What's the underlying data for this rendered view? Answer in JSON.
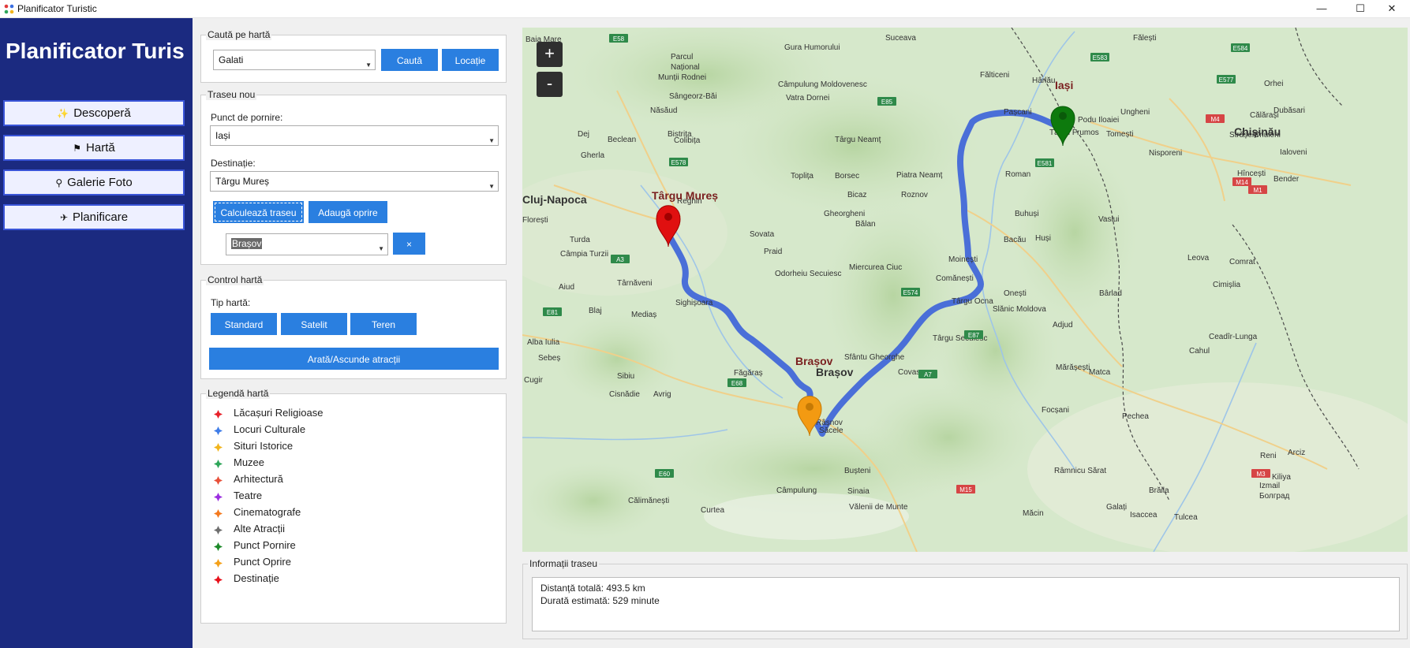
{
  "window": {
    "title": "Planificator Turistic",
    "minimize": "—",
    "maximize": "☐",
    "close": "✕"
  },
  "sidebar": {
    "app_title": "Planificator Turis",
    "items": [
      {
        "label": "Descoperă",
        "icon": "sparkle-icon",
        "glyph": "✨"
      },
      {
        "label": "Hartă",
        "icon": "flag-icon",
        "glyph": "⚑"
      },
      {
        "label": "Galerie Foto",
        "icon": "search-icon",
        "glyph": "⚲"
      },
      {
        "label": "Planificare",
        "icon": "airplane-icon",
        "glyph": "✈"
      }
    ]
  },
  "search": {
    "group_label": "Caută pe hartă",
    "value": "Galati",
    "search_button": "Caută",
    "location_button": "Locație"
  },
  "route": {
    "group_label": "Traseu nou",
    "start_label": "Punct de pornire:",
    "start_value": "Iași",
    "dest_label": "Destinație:",
    "dest_value": "Târgu Mureș",
    "calc_button": "Calculează traseu",
    "add_stop_button": "Adaugă oprire",
    "stop_value": "Brașov",
    "remove_stop_button": "×"
  },
  "map_control": {
    "group_label": "Control hartă",
    "type_label": "Tip hartă:",
    "standard": "Standard",
    "satellite": "Satelit",
    "terrain": "Teren",
    "toggle_attractions": "Arată/Ascunde atracții"
  },
  "legend": {
    "group_label": "Legendă hartă",
    "items": [
      {
        "label": "Lăcașuri Religioase",
        "color": "#e8222b"
      },
      {
        "label": "Locuri Culturale",
        "color": "#3f7de8"
      },
      {
        "label": "Situri Istorice",
        "color": "#f2b51d"
      },
      {
        "label": "Muzee",
        "color": "#2fa65a"
      },
      {
        "label": "Arhitectură",
        "color": "#e8503a"
      },
      {
        "label": "Teatre",
        "color": "#9b2ee0"
      },
      {
        "label": "Cinematografe",
        "color": "#f47a1f"
      },
      {
        "label": "Alte Atracții",
        "color": "#6f6f6f"
      },
      {
        "label": "Punct Pornire",
        "color": "#1d8a2a"
      },
      {
        "label": "Punct Oprire",
        "color": "#f4a11a"
      },
      {
        "label": "Destinație",
        "color": "#e8111b"
      }
    ]
  },
  "map": {
    "zoom_in": "+",
    "zoom_out": "-",
    "route_color": "#4a6fd8",
    "markers": {
      "start_label": "Iași",
      "stop_label": "Brașov",
      "dest_label": "Târgu Mureș"
    },
    "places": [
      {
        "name": "Baia Mare"
      },
      {
        "name": "Suceava"
      },
      {
        "name": "Parcul"
      },
      {
        "name": "Național"
      },
      {
        "name": "Munții Rodnei"
      },
      {
        "name": "Gura Humorului"
      },
      {
        "name": "Câmpulung Moldovenesc"
      },
      {
        "name": "Vatra Dornei"
      },
      {
        "name": "Sângeorz-Băi"
      },
      {
        "name": "Năsăud"
      },
      {
        "name": "Bistrița"
      },
      {
        "name": "Beclean"
      },
      {
        "name": "Dej"
      },
      {
        "name": "Gherla"
      },
      {
        "name": "Colibița"
      },
      {
        "name": "Cluj-Napoca"
      },
      {
        "name": "Florești"
      },
      {
        "name": "Turda"
      },
      {
        "name": "Câmpia Turzii"
      },
      {
        "name": "Aiud"
      },
      {
        "name": "Târnăveni"
      },
      {
        "name": "Blaj"
      },
      {
        "name": "Mediaș"
      },
      {
        "name": "Alba Iulia"
      },
      {
        "name": "Sebeș"
      },
      {
        "name": "Sibiu"
      },
      {
        "name": "Cugir"
      },
      {
        "name": "Cisnădie"
      },
      {
        "name": "Avrig"
      },
      {
        "name": "Făgăraș"
      },
      {
        "name": "Sighișoara"
      },
      {
        "name": "Sovata"
      },
      {
        "name": "Praid"
      },
      {
        "name": "Odorheiu Secuiesc"
      },
      {
        "name": "Reghin"
      },
      {
        "name": "Toplița"
      },
      {
        "name": "Borsec"
      },
      {
        "name": "Gheorgheni"
      },
      {
        "name": "Bălan"
      },
      {
        "name": "Miercurea Ciuc"
      },
      {
        "name": "Bicaz"
      },
      {
        "name": "Piatra Neamț"
      },
      {
        "name": "Roznov"
      },
      {
        "name": "Târgu Neamț"
      },
      {
        "name": "Fălticeni"
      },
      {
        "name": "Pașcani"
      },
      {
        "name": "Hârlău"
      },
      {
        "name": "Târgu Frumos"
      },
      {
        "name": "Podu Iloaiei"
      },
      {
        "name": "Roman"
      },
      {
        "name": "Buhuși"
      },
      {
        "name": "Bacău"
      },
      {
        "name": "Moinești"
      },
      {
        "name": "Comănești"
      },
      {
        "name": "Onești"
      },
      {
        "name": "Slănic Moldova"
      },
      {
        "name": "Târgu Ocna"
      },
      {
        "name": "Târgu Secuiesc"
      },
      {
        "name": "Adjud"
      },
      {
        "name": "Sfântu Gheorghe"
      },
      {
        "name": "Covasna"
      },
      {
        "name": "Brașov"
      },
      {
        "name": "Râșnov"
      },
      {
        "name": "Săcele"
      },
      {
        "name": "Bușteni"
      },
      {
        "name": "Sinaia"
      },
      {
        "name": "Câmpulung"
      },
      {
        "name": "Vălenii de Munte"
      },
      {
        "name": "Curtea"
      },
      {
        "name": "Călimănești"
      },
      {
        "name": "Focșani"
      },
      {
        "name": "Mărășești"
      },
      {
        "name": "Matca"
      },
      {
        "name": "Pechea"
      },
      {
        "name": "Galați"
      },
      {
        "name": "Brăila"
      },
      {
        "name": "Râmnicu Sărat"
      },
      {
        "name": "Măcin"
      },
      {
        "name": "Isaccea"
      },
      {
        "name": "Tulcea"
      },
      {
        "name": "Fălești"
      },
      {
        "name": "Ungheni"
      },
      {
        "name": "Tomești"
      },
      {
        "name": "Nisporeni"
      },
      {
        "name": "Chișinău"
      },
      {
        "name": "Orhei"
      },
      {
        "name": "Călărași"
      },
      {
        "name": "Strășeni"
      },
      {
        "name": "Criuleni"
      },
      {
        "name": "Dubăsari"
      },
      {
        "name": "Ialoveni"
      },
      {
        "name": "Hîncești"
      },
      {
        "name": "Bender"
      },
      {
        "name": "Vaslui"
      },
      {
        "name": "Leova"
      },
      {
        "name": "Comrat"
      },
      {
        "name": "Bârlad"
      },
      {
        "name": "Cimișlia"
      },
      {
        "name": "Cahul"
      },
      {
        "name": "Ceadîr-Lunga"
      },
      {
        "name": "Reni"
      },
      {
        "name": "Izmail"
      },
      {
        "name": "Kiliya"
      },
      {
        "name": "Болград"
      },
      {
        "name": "Arciz"
      },
      {
        "name": "Huși"
      },
      {
        "name": "Târgu Mureș"
      },
      {
        "name": "Iași"
      }
    ],
    "roads": [
      "E58",
      "E583",
      "E85",
      "E578",
      "E581",
      "E574",
      "E60",
      "E68",
      "E81",
      "A3",
      "E584",
      "E87",
      "M14",
      "M1",
      "M3",
      "M15",
      "A7",
      "E577",
      "M4"
    ]
  },
  "info": {
    "group_label": "Informații traseu",
    "distance": "Distanță totală: 493.5 km",
    "duration": "Durată estimată: 529 minute"
  }
}
